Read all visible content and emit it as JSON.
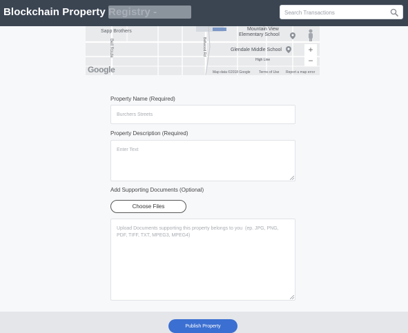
{
  "header": {
    "app_title": "Blockchain Property Registry -",
    "search_placeholder": "Search Transactions"
  },
  "map": {
    "labels": {
      "sapp_brothers": "Sapp Brothers",
      "mountain_view": "Mountain View",
      "elementary": "Elementary School",
      "glendale": "Glendale Middle School",
      "high_line": "High Line",
      "bell_route": "Bell Route",
      "road_1": "Bellwood Rd"
    },
    "google": "Google",
    "footer": {
      "map_data": "Map data ©2018 Google",
      "terms": "Terms of Use",
      "report": "Report a map error"
    },
    "zoom_in": "+",
    "zoom_out": "−"
  },
  "form": {
    "property_name": {
      "label": "Property Name (Required)",
      "placeholder": "Burchers Streets"
    },
    "property_description": {
      "label": "Property Description (Required)",
      "placeholder": "Enter Text"
    },
    "supporting_documents": {
      "label": "Add Supporting Documents (Optional)",
      "button": "Choose Files",
      "placeholder": "Upload Documents supporting this property belongs to you  (ep. JPG, PNG, PDF, TIFF, TXT, MPEG3, MPEG4)"
    },
    "publish_button": "Publish Property"
  },
  "colors": {
    "header_bg": "#3b4552",
    "publish_bg": "#3b6fd1",
    "page_bg": "#f7f8fa"
  }
}
